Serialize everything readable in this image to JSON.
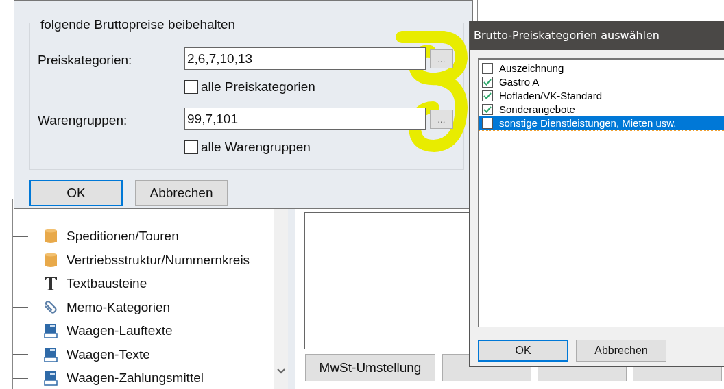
{
  "price_dialog": {
    "group_title": "folgende Bruttopreise beibehalten",
    "fields": [
      {
        "label": "Preiskategorien:",
        "value": "2,6,7,10,13",
        "browse": "...",
        "all_label": "alle Preiskategorien",
        "all_checked": false
      },
      {
        "label": "Warengruppen:",
        "value": "99,7,101",
        "browse": "...",
        "all_label": "alle Warengruppen",
        "all_checked": false
      }
    ],
    "buttons": [
      {
        "label": "OK",
        "default": true
      },
      {
        "label": "Abbrechen",
        "default": false
      }
    ]
  },
  "tree": {
    "items": [
      {
        "label": "Speditionen/Touren",
        "kind": "db"
      },
      {
        "label": "Vertriebsstruktur/Nummernkreis",
        "kind": "db"
      },
      {
        "label": "Textbausteine",
        "kind": "text"
      },
      {
        "label": "Memo-Kategorien",
        "kind": "clip"
      },
      {
        "label": "Waagen-Lauftexte",
        "kind": "scale"
      },
      {
        "label": "Waagen-Texte",
        "kind": "scale"
      },
      {
        "label": "Waagen-Zahlungsmittel",
        "kind": "scale"
      }
    ]
  },
  "main_buttons": [
    {
      "label": "MwSt-Umstellung"
    }
  ],
  "category_dialog": {
    "title": "Brutto-Preiskategorien auswählen",
    "items": [
      {
        "label": "Auszeichnung",
        "checked": false,
        "selected": false
      },
      {
        "label": "Gastro A",
        "checked": true,
        "selected": false
      },
      {
        "label": "Hofladen/VK-Standard",
        "checked": true,
        "selected": false
      },
      {
        "label": "Sonderangebote",
        "checked": true,
        "selected": false
      },
      {
        "label": "sonstige Dienstleistungen, Mieten usw.",
        "checked": false,
        "selected": true
      }
    ],
    "buttons": [
      {
        "label": "OK",
        "default": true
      },
      {
        "label": "Abbrechen",
        "default": false
      }
    ]
  }
}
